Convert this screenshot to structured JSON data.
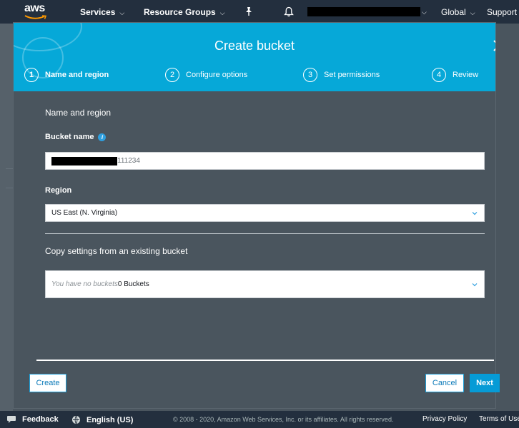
{
  "topbar": {
    "logo_text": "aws",
    "services_label": "Services",
    "groups_label": "Resource Groups",
    "global_label": "Global",
    "support_label": "Support",
    "pin_icon": "pushpin-icon",
    "bell_icon": "bell-icon"
  },
  "modal": {
    "title": "Create bucket",
    "close_icon": "close-icon",
    "steps": [
      {
        "num": "1",
        "label": "Name and region",
        "active": true
      },
      {
        "num": "2",
        "label": "Configure options",
        "active": false
      },
      {
        "num": "3",
        "label": "Set permissions",
        "active": false
      },
      {
        "num": "4",
        "label": "Review",
        "active": false
      }
    ],
    "section_title": "Name and region",
    "bucket_name_label": "Bucket name",
    "bucket_name_value": "111234",
    "region_label": "Region",
    "region_value": "US East (N. Virginia)",
    "copy_title": "Copy settings from an existing bucket",
    "copy_placeholder": "You have no buckets",
    "copy_count": "0 Buckets",
    "create_label": "Create",
    "cancel_label": "Cancel",
    "next_label": "Next"
  },
  "footer": {
    "feedback_label": "Feedback",
    "language_label": "English (US)",
    "copyright": "© 2008 - 2020, Amazon Web Services, Inc. or its affiliates. All rights reserved.",
    "privacy_label": "Privacy Policy",
    "terms_label": "Terms of Use"
  },
  "colors": {
    "header_accent": "#06a8d8",
    "primary_button": "#069bd6",
    "nav_background": "#232f3e",
    "modal_body": "#4a555e"
  }
}
